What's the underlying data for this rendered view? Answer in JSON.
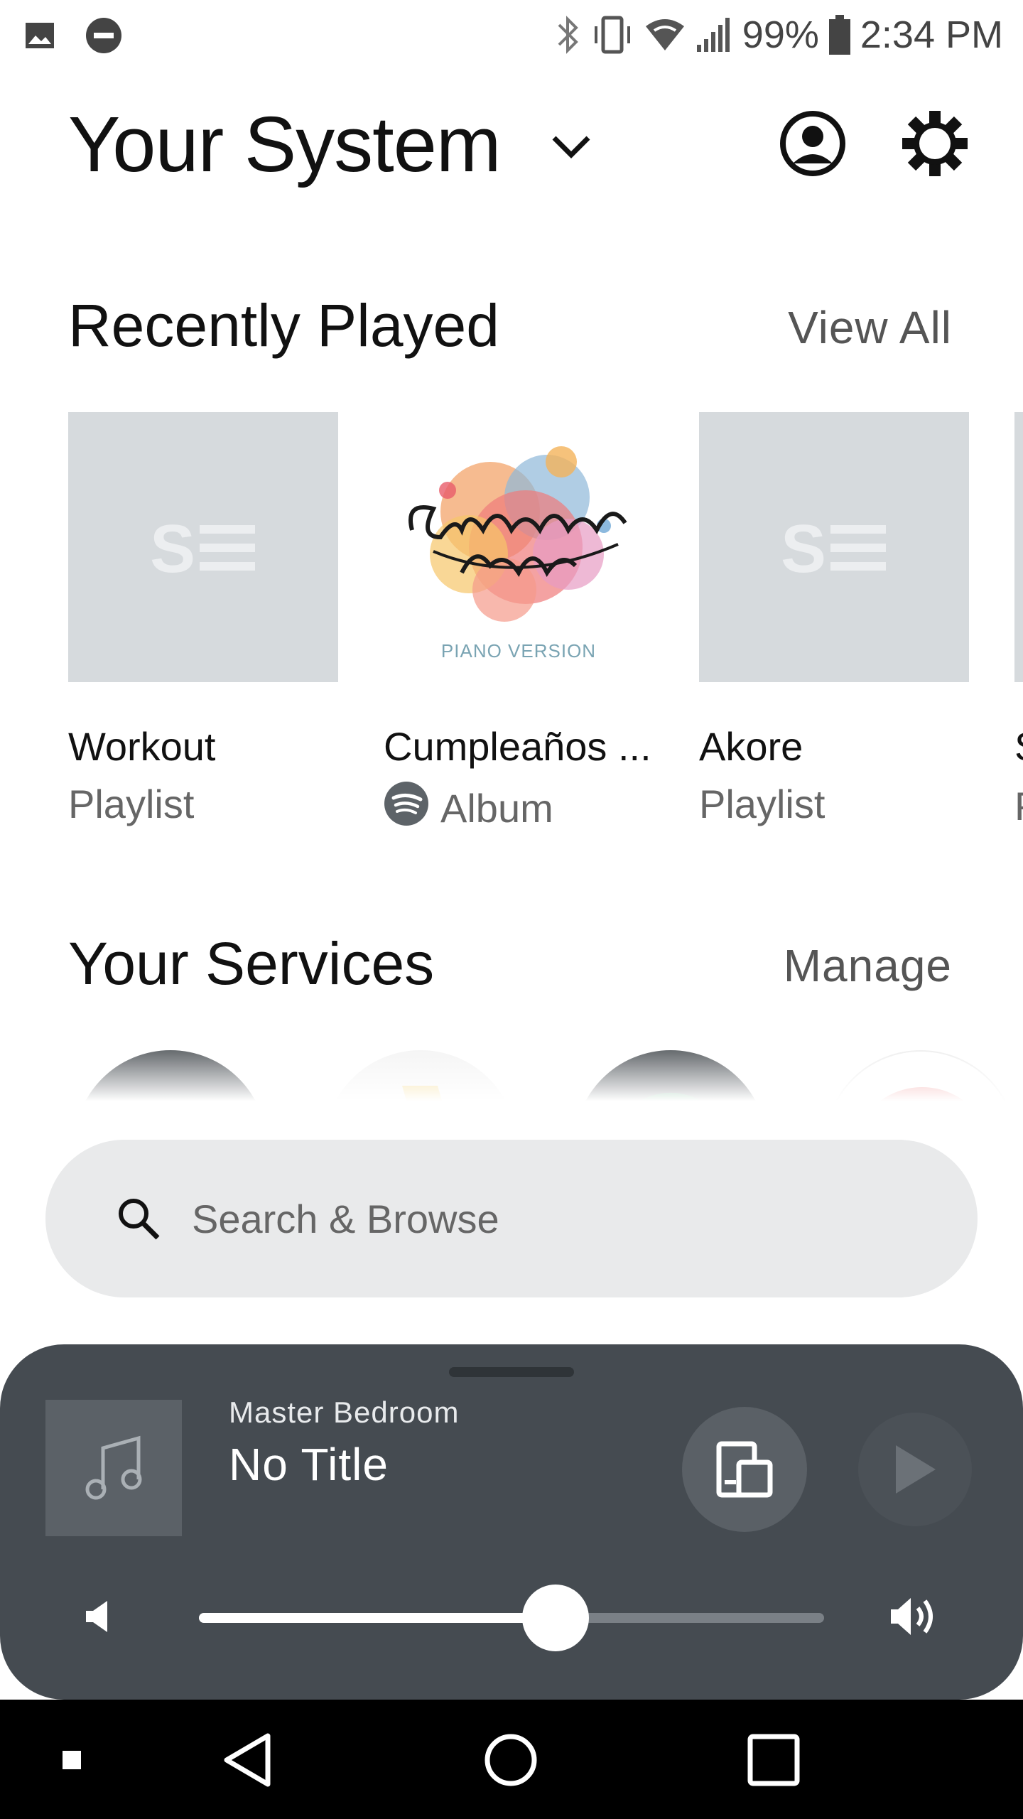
{
  "status_bar": {
    "battery": "99%",
    "time": "2:34 PM",
    "icons": [
      "gallery-icon",
      "do-not-disturb-icon",
      "bluetooth-icon",
      "vibrate-icon",
      "wifi-icon",
      "signal-icon",
      "battery-icon"
    ]
  },
  "header": {
    "title": "Your System",
    "icons": [
      "chevron-down-icon",
      "account-icon",
      "settings-icon"
    ]
  },
  "recently_played": {
    "heading": "Recently Played",
    "link": "View All",
    "items": [
      {
        "title": "Workout",
        "subtitle": "Playlist",
        "art": "playlist-placeholder"
      },
      {
        "title": "Cumpleaños ...",
        "subtitle": "Album",
        "art": "cumpleanos-feliz-cover",
        "art_text": "PIANO VERSION",
        "service_icon": "spotify-icon"
      },
      {
        "title": "Akore",
        "subtitle": "Playlist",
        "art": "playlist-placeholder"
      }
    ],
    "partial_title": "S",
    "partial_subtitle": "P"
  },
  "services": {
    "heading": "Your Services",
    "link": "Manage",
    "colors": [
      "#555a5e",
      "#f1c232",
      "#2ecc71",
      "#e84c4c"
    ]
  },
  "search": {
    "placeholder": "Search & Browse"
  },
  "now_playing": {
    "room": "Master Bedroom",
    "title": "No Title",
    "volume_percent": 57
  },
  "colors": {
    "panel": "#454b51",
    "accent": "#ffffff",
    "placeholder_art": "#d6dadd"
  }
}
